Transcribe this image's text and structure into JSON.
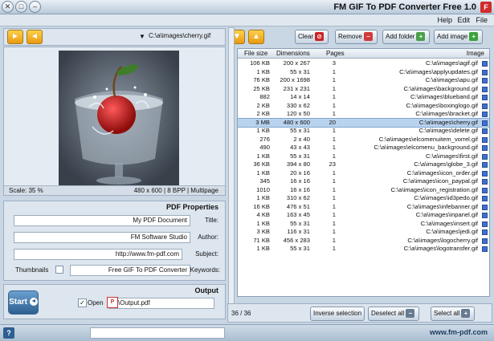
{
  "window": {
    "title": "FM GIF To PDF Converter Free 1.0"
  },
  "menu": {
    "file": "File",
    "edit": "Edit",
    "help": "Help"
  },
  "toolbar": {
    "add_image": "Add image",
    "add_folder": "Add folder",
    "remove": "Remove",
    "clear": "Clear",
    "path": "C:\\a\\images\\cherry.gif"
  },
  "table": {
    "headers": {
      "image": "Image",
      "pages": "Pages",
      "dimensions": "Dimensions",
      "file_size": "File size"
    },
    "rows": [
      {
        "image": "C:\\a\\images\\agif.gif",
        "pages": "3",
        "dim": "200 x 267",
        "size": "106 KB"
      },
      {
        "image": "C:\\a\\images\\applyupdates.gif",
        "pages": "1",
        "dim": "55 x 31",
        "size": "1 KB"
      },
      {
        "image": "C:\\a\\images\\apu.gif",
        "pages": "1",
        "dim": "200 x 1698",
        "size": "76 KB"
      },
      {
        "image": "C:\\a\\images\\background.gif",
        "pages": "1",
        "dim": "231 x 231",
        "size": "25 KB"
      },
      {
        "image": "C:\\a\\images\\blueband.gif",
        "pages": "1",
        "dim": "14 x 14",
        "size": "882"
      },
      {
        "image": "C:\\a\\images\\boxinglogo.gif",
        "pages": "1",
        "dim": "330 x 62",
        "size": "2 KB"
      },
      {
        "image": "C:\\a\\images\\bracket.gif",
        "pages": "1",
        "dim": "120 x 50",
        "size": "2 KB"
      },
      {
        "image": "C:\\a\\images\\cherry.gif",
        "pages": "20",
        "dim": "480 x 600",
        "size": "3 MB"
      },
      {
        "image": "C:\\a\\images\\delete.gif",
        "pages": "1",
        "dim": "55 x 31",
        "size": "1 KB"
      },
      {
        "image": "C:\\a\\images\\elcomenuitem_vorrel.gif",
        "pages": "1",
        "dim": "2 x 40",
        "size": "276"
      },
      {
        "image": "C:\\a\\images\\elcomenu_background.gif",
        "pages": "1",
        "dim": "43 x 43",
        "size": "490"
      },
      {
        "image": "C:\\a\\images\\first.gif",
        "pages": "1",
        "dim": "55 x 31",
        "size": "1 KB"
      },
      {
        "image": "C:\\a\\images\\globe_3.gif",
        "pages": "23",
        "dim": "394 x 80",
        "size": "36 KB"
      },
      {
        "image": "C:\\a\\images\\icon_order.gif",
        "pages": "1",
        "dim": "20 x 16",
        "size": "1 KB"
      },
      {
        "image": "C:\\a\\images\\icon_paypal.gif",
        "pages": "1",
        "dim": "16 x 16",
        "size": "345"
      },
      {
        "image": "C:\\a\\images\\icon_registration.gif",
        "pages": "1",
        "dim": "16 x 16",
        "size": "1010"
      },
      {
        "image": "C:\\a\\images\\id3pedo.gif",
        "pages": "1",
        "dim": "310 x 62",
        "size": "1 KB"
      },
      {
        "image": "C:\\a\\images\\infebanner.gif",
        "pages": "1",
        "dim": "476 x 51",
        "size": "16 KB"
      },
      {
        "image": "C:\\a\\images\\inpanel.gif",
        "pages": "1",
        "dim": "163 x 45",
        "size": "4 KB"
      },
      {
        "image": "C:\\a\\images\\insert.gif",
        "pages": "1",
        "dim": "55 x 31",
        "size": "1 KB"
      },
      {
        "image": "C:\\a\\images\\jedi.gif",
        "pages": "1",
        "dim": "116 x 31",
        "size": "3 KB"
      },
      {
        "image": "C:\\a\\images\\logocherry.gif",
        "pages": "1",
        "dim": "456 x 283",
        "size": "71 KB"
      },
      {
        "image": "C:\\a\\images\\logotransfer.gif",
        "pages": "1",
        "dim": "55 x 31",
        "size": "1 KB"
      }
    ]
  },
  "list_actions": {
    "select_all": "Select all",
    "deselect_all": "Deselect all",
    "inverse_selection": "Inverse selection",
    "count": "36 / 36"
  },
  "preview": {
    "info": "480 x 600 | 8 BPP | Multipage",
    "scale": "Scale: 35 %"
  },
  "pdf_properties": {
    "section_title": "PDF Properties",
    "title_label": "Title:",
    "title_value": "My PDF Document",
    "author_label": "Author:",
    "author_value": "FM Software Studio",
    "subject_label": "Subject:",
    "subject_value": "http://www.fm-pdf.com",
    "keywords_label": "Keywords:",
    "keywords_value": "Free GIF To PDF Converter",
    "thumbnails_label": "Thumbnails"
  },
  "output": {
    "section_title": "Output",
    "path_value": "C:\\Output.pdf",
    "open_label": "Open",
    "start_label": "Start"
  },
  "status": {
    "website": "www.fm-pdf.com"
  },
  "colors": {
    "accent_blue": "#3d6fd1",
    "selection": "#b9d3ef",
    "arrow_orange": "#f0a818"
  }
}
